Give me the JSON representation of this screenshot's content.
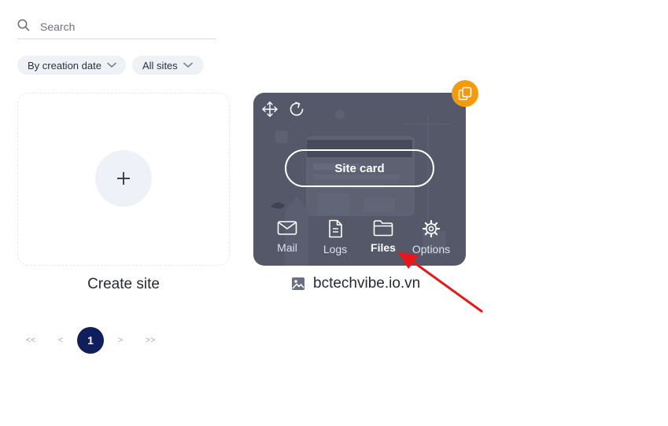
{
  "search": {
    "placeholder": "Search",
    "value": ""
  },
  "filters": [
    {
      "label": "By creation date"
    },
    {
      "label": "All sites"
    }
  ],
  "create_site": {
    "label": "Create site"
  },
  "site": {
    "name": "bctechvibe.io.vn",
    "card_button": "Site card",
    "actions": [
      {
        "label": "Mail",
        "icon": "mail-icon"
      },
      {
        "label": "Logs",
        "icon": "document-icon"
      },
      {
        "label": "Files",
        "icon": "folder-icon"
      },
      {
        "label": "Options",
        "icon": "gear-icon"
      }
    ]
  },
  "pagination": {
    "first": "<<",
    "prev": "<",
    "current": "1",
    "next": ">",
    "last": ">>"
  },
  "colors": {
    "accent_orange": "#f59a0c",
    "pager_active": "#0e1f5b",
    "card_bg": "#5b6072",
    "annotation_arrow": "#e3191b"
  }
}
